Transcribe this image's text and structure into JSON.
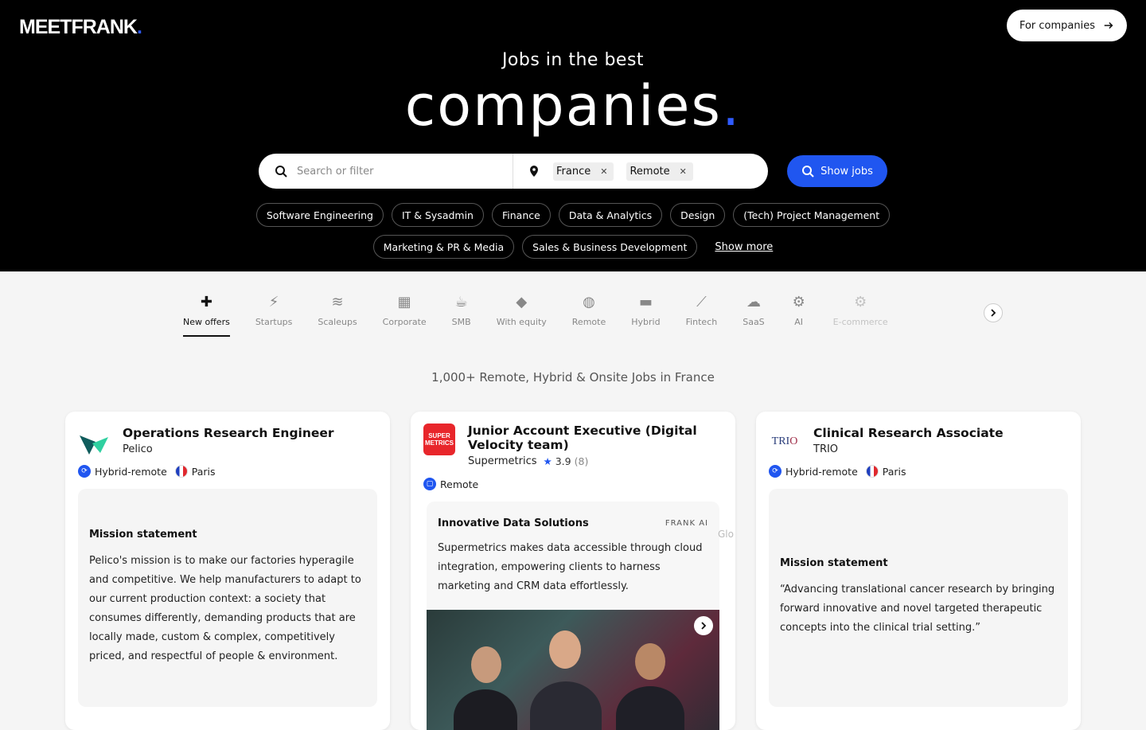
{
  "header": {
    "logo": "MEETFRANK",
    "logo_dot": ".",
    "for_companies_label": "For companies",
    "subtitle": "Jobs in the best",
    "title": "companies",
    "title_dot": "."
  },
  "search": {
    "placeholder": "Search or filter",
    "location_chips": [
      "France",
      "Remote"
    ],
    "show_jobs_label": "Show jobs"
  },
  "categories_row1": [
    "Software Engineering",
    "IT & Sysadmin",
    "Finance",
    "Data & Analytics",
    "Design",
    "(Tech) Project Management"
  ],
  "categories_row2": [
    "Marketing & PR & Media",
    "Sales & Business Development"
  ],
  "show_more_label": "Show more",
  "filters": [
    {
      "label": "New offers",
      "icon": "badge-plus-icon",
      "active": true
    },
    {
      "label": "Startups",
      "icon": "lightning-icon"
    },
    {
      "label": "Scaleups",
      "icon": "double-lightning-icon"
    },
    {
      "label": "Corporate",
      "icon": "building-icon"
    },
    {
      "label": "SMB",
      "icon": "coffee-icon"
    },
    {
      "label": "With equity",
      "icon": "diamond-icon"
    },
    {
      "label": "Remote",
      "icon": "globe-icon"
    },
    {
      "label": "Hybrid",
      "icon": "laptop-icon"
    },
    {
      "label": "Fintech",
      "icon": "chart-icon"
    },
    {
      "label": "SaaS",
      "icon": "cloud-icon"
    },
    {
      "label": "AI",
      "icon": "robot-icon"
    },
    {
      "label": "E-commerce",
      "icon": "cart-icon"
    }
  ],
  "results_count": "1,000+ Remote, Hybrid & Onsite Jobs in France",
  "jobs": [
    {
      "title": "Operations Research Engineer",
      "company": "Pelico",
      "work_type": "Hybrid-remote",
      "location": "Paris",
      "section_title": "Mission statement",
      "section_text": "Pelico's mission is to make our factories hyperagile and competitive. We help manufacturers to adapt to our current production context: a society that consumes differently, demanding products that are locally made, custom & complex, competitively priced, and respectful of people & environment."
    },
    {
      "title": "Junior Account Executive (Digital Velocity team)",
      "company": "Supermetrics",
      "rating": "3.9",
      "rating_count": "(8)",
      "work_type": "Remote",
      "ai_title": "Innovative Data Solutions",
      "ai_badge": "FRANK AI",
      "ai_text": "Supermetrics makes data accessible through cloud integration, empowering clients to harness marketing and CRM data effortlessly.",
      "peek_text": "Glo"
    },
    {
      "title": "Clinical Research Associate",
      "company": "TRIO",
      "work_type": "Hybrid-remote",
      "location": "Paris",
      "section_title": "Mission statement",
      "section_text": "“Advancing translational cancer research by bringing forward innovative and novel targeted therapeutic concepts into the clinical trial setting.”"
    }
  ],
  "colors": {
    "accent": "#2056f0",
    "hero_bg": "#000000"
  }
}
